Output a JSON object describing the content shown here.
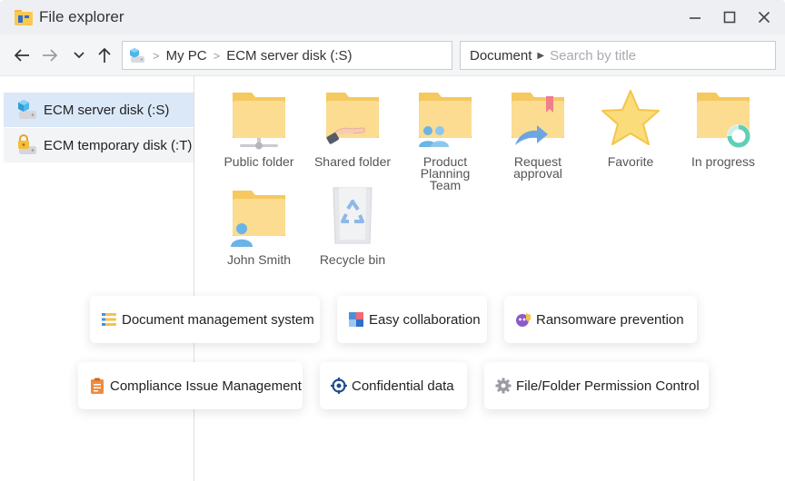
{
  "window": {
    "title": "File explorer"
  },
  "address": {
    "root": "My PC",
    "current": "ECM server disk (:S)"
  },
  "search": {
    "scope": "Document",
    "placeholder": "Search by title"
  },
  "sidebar": {
    "items": [
      {
        "label": "ECM server disk (:S)",
        "icon": "server-disk-icon"
      },
      {
        "label": "ECM temporary disk (:T)",
        "icon": "locked-disk-icon"
      }
    ]
  },
  "files": [
    {
      "label": "Public folder",
      "icon": "network-folder-icon"
    },
    {
      "label": "Shared folder",
      "icon": "shared-folder-icon"
    },
    {
      "label": "Product Planning Team",
      "icon": "team-folder-icon"
    },
    {
      "label": "Request approval",
      "icon": "approval-folder-icon"
    },
    {
      "label": "Favorite",
      "icon": "star-icon"
    },
    {
      "label": "In progress",
      "icon": "progress-folder-icon"
    },
    {
      "label": "John Smith",
      "icon": "user-folder-icon"
    },
    {
      "label": "Recycle bin",
      "icon": "recycle-bin-icon"
    }
  ],
  "features": [
    {
      "label": "Document management system",
      "icon": "document-stack-icon"
    },
    {
      "label": "Easy collaboration",
      "icon": "collaboration-icon"
    },
    {
      "label": "Ransomware prevention",
      "icon": "virus-shield-icon"
    },
    {
      "label": "Compliance Issue Management",
      "icon": "clipboard-icon"
    },
    {
      "label": "Confidential data",
      "icon": "target-lock-icon"
    },
    {
      "label": "File/Folder Permission Control",
      "icon": "gear-icon"
    }
  ],
  "colors": {
    "folder": "#fad98a",
    "folder_back": "#f5c95f",
    "accent": "#4a90d9",
    "selected_bg": "#dbe8f8"
  }
}
